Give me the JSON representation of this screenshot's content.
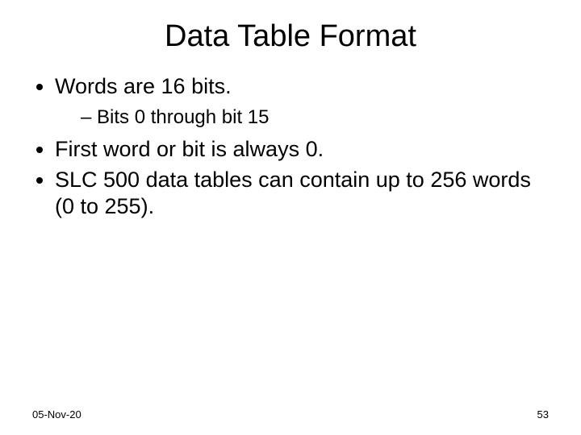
{
  "slide": {
    "title": "Data Table Format",
    "bullets": {
      "b1": "Words are 16 bits.",
      "b1_sub1": "Bits 0 through bit 15",
      "b2": "First word or bit is always 0.",
      "b3": "SLC 500 data tables can contain up to 256 words (0 to 255)."
    },
    "footer": {
      "date": "05-Nov-20",
      "page": "53"
    }
  }
}
